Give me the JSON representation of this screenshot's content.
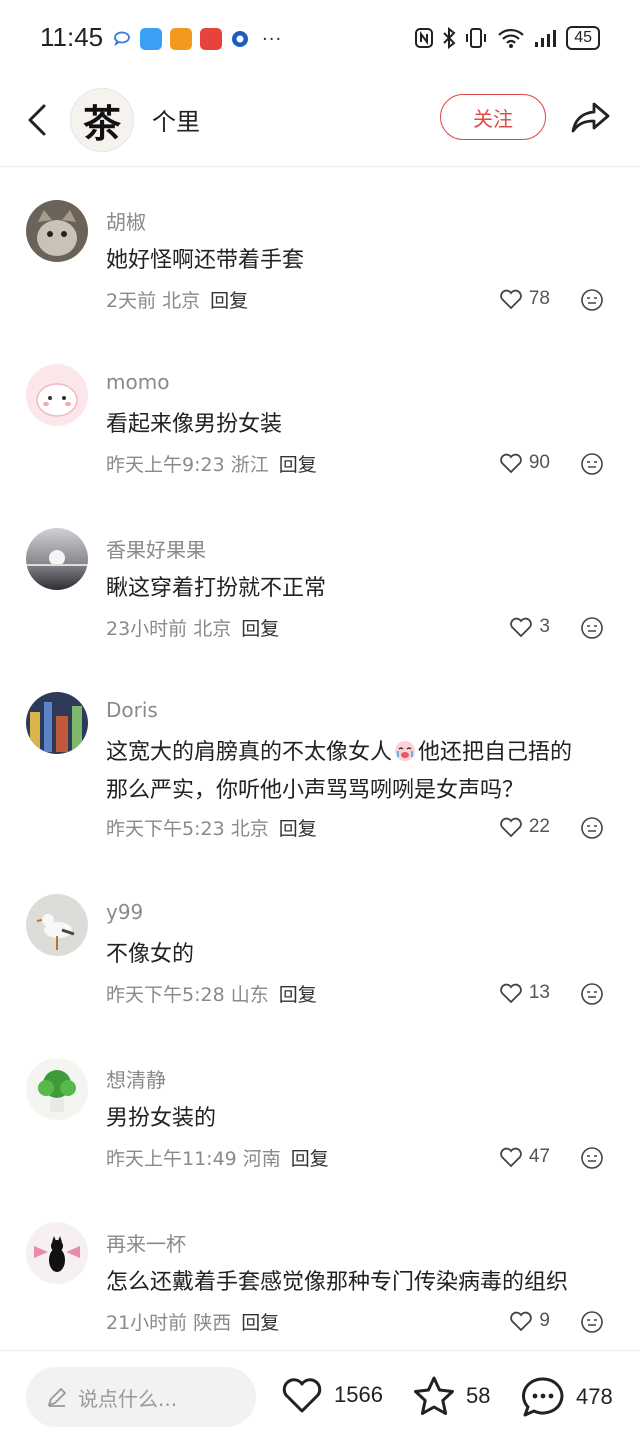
{
  "status": {
    "time": "11:45",
    "dots": "···",
    "battery": "45"
  },
  "header": {
    "avatar_char": "茶",
    "account_name": "个里",
    "follow_label": "关注"
  },
  "comments": [
    {
      "user": "胡椒",
      "text": "她好怪啊还带着手套",
      "time_loc": "2天前 北京",
      "reply": "回复",
      "likes": "78"
    },
    {
      "user": "momo",
      "text": "看起来像男扮女装",
      "time_loc": "昨天上午9:23 浙江",
      "reply": "回复",
      "likes": "90"
    },
    {
      "user": "香果好果果",
      "text": "瞅这穿着打扮就不正常",
      "time_loc": "23小时前 北京",
      "reply": "回复",
      "likes": "3"
    },
    {
      "user": "Doris",
      "text_line1": "这宽大的肩膀真的不太像女人",
      "text_line1b": "他还把自己捂的",
      "text_line2": "那么严实，你听他小声骂骂咧咧是女声吗？",
      "time_loc": "昨天下午5:23 北京",
      "reply": "回复",
      "likes": "22"
    },
    {
      "user": "y99",
      "text": "不像女的",
      "time_loc": "昨天下午5:28 山东",
      "reply": "回复",
      "likes": "13"
    },
    {
      "user": "想清静",
      "text": "男扮女装的",
      "time_loc": "昨天上午11:49 河南",
      "reply": "回复",
      "likes": "47"
    },
    {
      "user": "再来一杯",
      "text": "怎么还戴着手套感觉像那种专门传染病毒的组织",
      "time_loc": "21小时前 陕西",
      "reply": "回复",
      "likes": "9"
    }
  ],
  "bottom": {
    "placeholder": "说点什么...",
    "likes": "1566",
    "favorites": "58",
    "comments": "478"
  },
  "colors": {
    "accent": "#e04a4a",
    "meta_gray": "#8a8a8a"
  }
}
